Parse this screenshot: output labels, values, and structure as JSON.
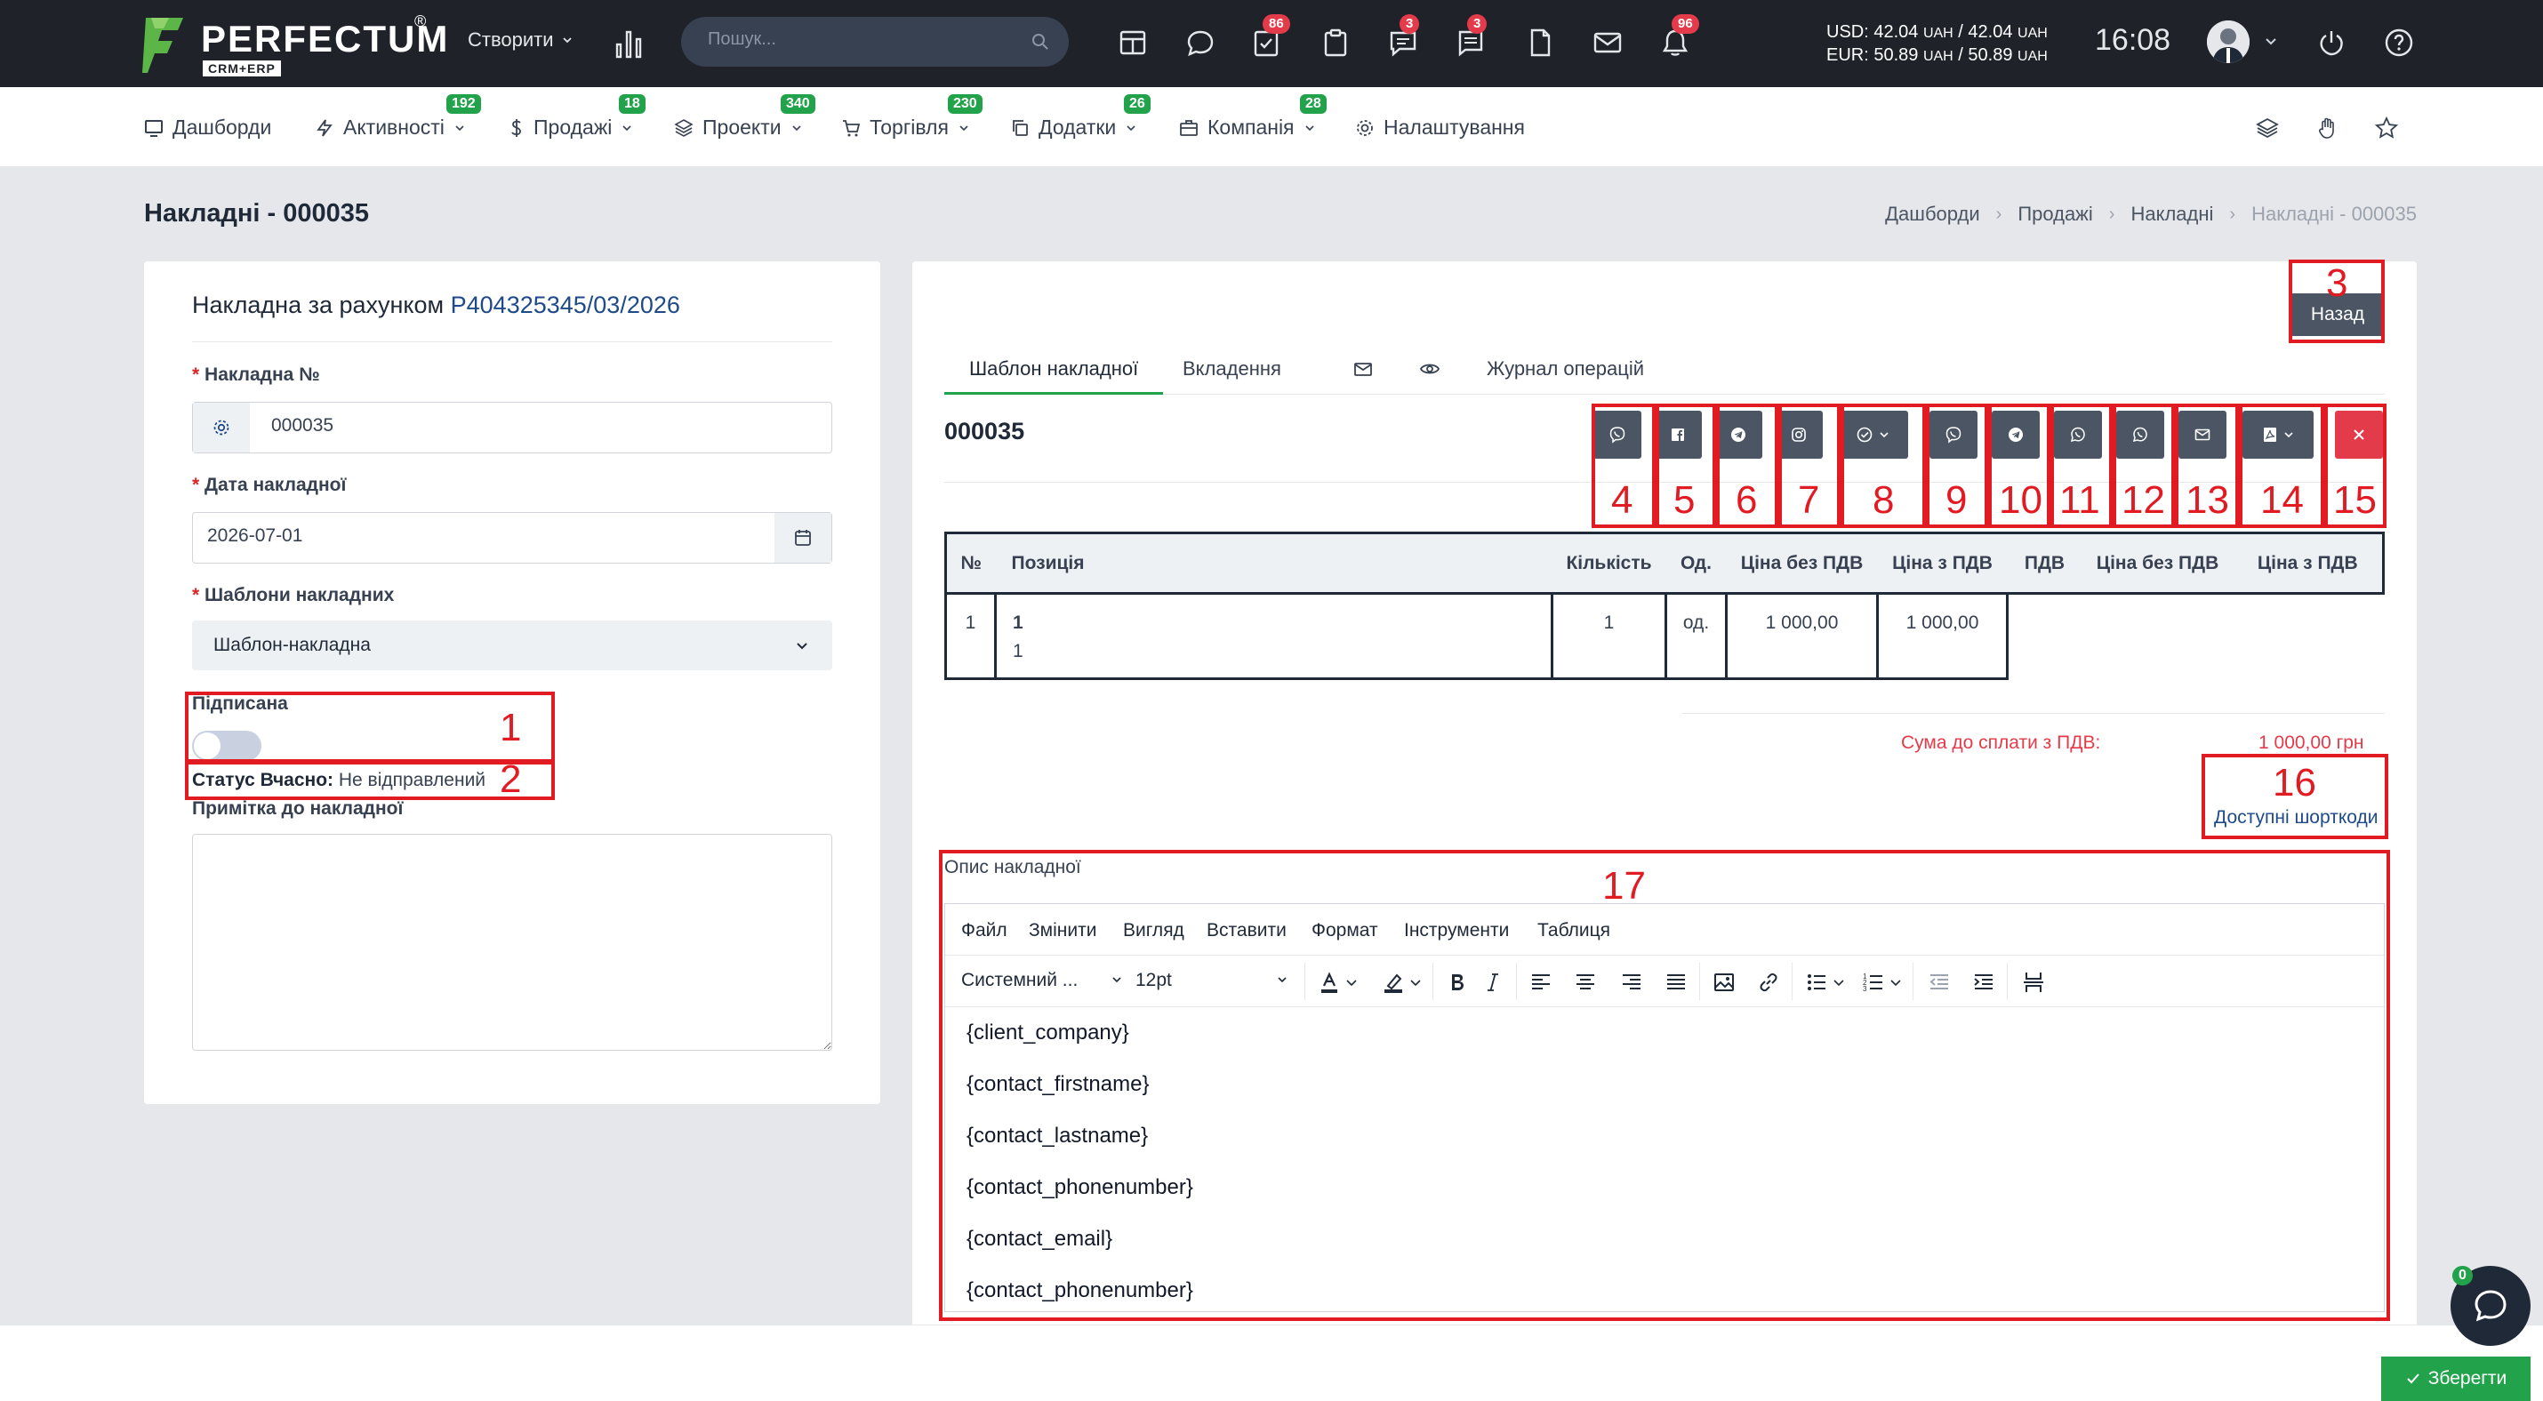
{
  "topbar": {
    "logo_text": "PERFECTUM",
    "logo_reg": "®",
    "logo_sub": "CRM+ERP",
    "create_label": "Створити",
    "search_placeholder": "Пошук...",
    "badges": {
      "tasks": "86",
      "chat": "3",
      "messages": "3",
      "notifications": "96"
    },
    "currency_usd": "USD: 42.04",
    "currency_usd_rest": "UAH / 42.04",
    "currency_eur": "EUR: 50.89",
    "currency_eur_rest": "UAH / 50.89",
    "currency_unit": "UAH",
    "time": "16:08"
  },
  "nav": {
    "items": [
      {
        "label": "Дашборди",
        "badge": "",
        "icon": "monitor-icon"
      },
      {
        "label": "Активності",
        "badge": "192",
        "icon": "bolt-icon"
      },
      {
        "label": "Продажі",
        "badge": "18",
        "icon": "dollar-icon"
      },
      {
        "label": "Проекти",
        "badge": "340",
        "icon": "layers-icon"
      },
      {
        "label": "Торгівля",
        "badge": "230",
        "icon": "cart-icon"
      },
      {
        "label": "Додатки",
        "badge": "26",
        "icon": "copy-icon"
      },
      {
        "label": "Компанія",
        "badge": "28",
        "icon": "briefcase-icon"
      },
      {
        "label": "Налаштування",
        "badge": "",
        "icon": "gear-icon"
      }
    ]
  },
  "page": {
    "title": "Накладні - 000035",
    "breadcrumbs": [
      "Дашборди",
      "Продажі",
      "Накладні",
      "Накладні - 000035"
    ]
  },
  "form": {
    "title_prefix": "Накладна за рахунком",
    "title_link": "P404325345/03/2026",
    "number_label": "Накладна №",
    "number_value": "000035",
    "date_label": "Дата накладної",
    "date_value": "2026-07-01",
    "template_label": "Шаблони накладних",
    "template_value": "Шаблон-накладна",
    "signed_label": "Підписана",
    "status_label": "Статус Вчасно:",
    "status_value": "Не відправлений",
    "note_label": "Примітка до накладної",
    "note_value": ""
  },
  "doc": {
    "back_label": "Назад",
    "tabs": [
      "Шаблон накладної",
      "Вкладення",
      "Журнал операцій"
    ],
    "number": "000035",
    "table": {
      "headers": [
        "№",
        "Позиція",
        "Кількість",
        "Од.",
        "Ціна без ПДВ",
        "Ціна з ПДВ",
        "ПДВ",
        "Ціна без ПДВ",
        "Ціна з ПДВ"
      ],
      "row": {
        "num": "1",
        "pos_name": "1",
        "pos_desc": "1",
        "qty": "1",
        "unit": "од.",
        "price_net": "1 000,00",
        "price_gross": "1 000,00"
      }
    },
    "total_label": "Сума до сплати з ПДВ:",
    "total_value": "1 000,00 грн",
    "shortcodes_label": "Доступні шорткоди",
    "desc_label": "Опис накладної",
    "editor": {
      "menu": [
        "Файл",
        "Змінити",
        "Вигляд",
        "Вставити",
        "Формат",
        "Інструменти",
        "Таблиця"
      ],
      "font_family": "Системний ...",
      "font_size": "12pt",
      "lines": [
        "{client_company}",
        "{contact_firstname}",
        "{contact_lastname}",
        "{contact_phonenumber}",
        "{contact_email}",
        "{contact_phonenumber}"
      ]
    }
  },
  "annotations": [
    "1",
    "2",
    "3",
    "4",
    "5",
    "6",
    "7",
    "8",
    "9",
    "10",
    "11",
    "12",
    "13",
    "14",
    "15",
    "16",
    "17"
  ],
  "footer": {
    "save_label": "Зберегти",
    "chat_badge": "0"
  },
  "colors": {
    "accent_green": "#22a24a",
    "danger_red": "#e43b4a",
    "annotation_red": "#e21a22",
    "link_blue": "#1f4a8a",
    "topbar_bg": "#1f2329"
  }
}
